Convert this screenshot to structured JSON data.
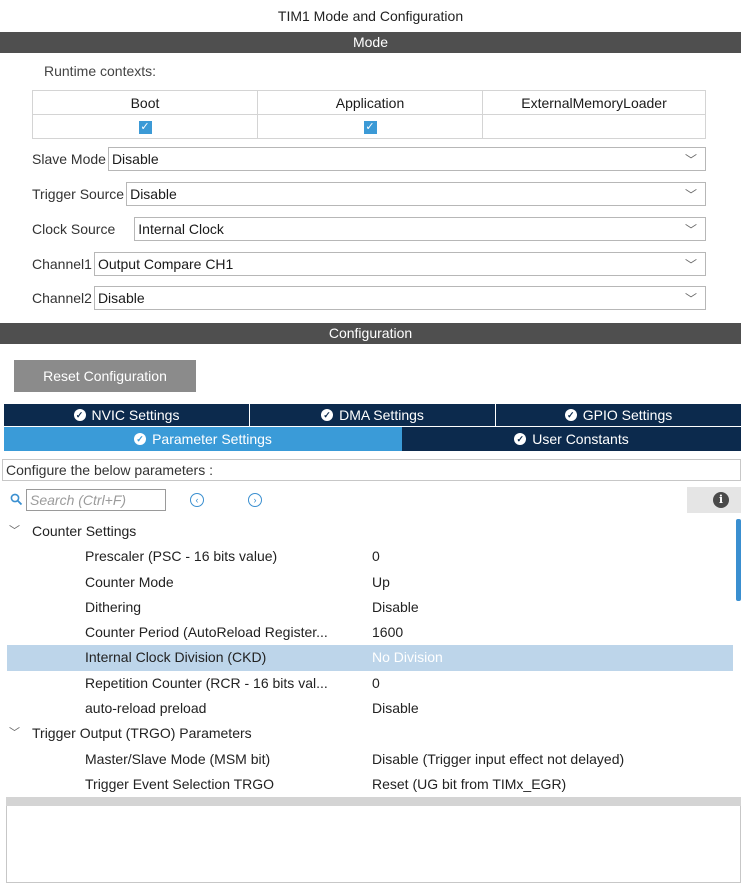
{
  "window": {
    "title": "TIM1 Mode and Configuration"
  },
  "mode": {
    "header": "Mode",
    "runtime_contexts_label": "Runtime contexts:",
    "contexts": [
      {
        "label": "Boot",
        "checked": true
      },
      {
        "label": "Application",
        "checked": true
      },
      {
        "label": "ExternalMemoryLoader",
        "checked": false
      }
    ],
    "fields": [
      {
        "label": "Slave Mode",
        "value": "Disable"
      },
      {
        "label": "Trigger Source",
        "value": "Disable"
      },
      {
        "label": "Clock Source",
        "value": "Internal Clock"
      },
      {
        "label": "Channel1",
        "value": "Output Compare CH1"
      },
      {
        "label": "Channel2",
        "value": "Disable"
      }
    ]
  },
  "configuration": {
    "header": "Configuration",
    "reset_button": "Reset Configuration",
    "tabs_row1": [
      "NVIC Settings",
      "DMA Settings",
      "GPIO Settings"
    ],
    "tabs_row2": [
      "Parameter Settings",
      "User Constants"
    ],
    "active_tab": "Parameter Settings",
    "configure_text": "Configure the below parameters :",
    "search_placeholder": "Search (Ctrl+F)",
    "groups": [
      {
        "name": "Counter Settings",
        "params": [
          {
            "name": "Prescaler (PSC - 16 bits value)",
            "value": "0"
          },
          {
            "name": "Counter Mode",
            "value": "Up"
          },
          {
            "name": "Dithering",
            "value": "Disable"
          },
          {
            "name": "Counter Period (AutoReload Register...",
            "value": "1600"
          },
          {
            "name": "Internal Clock Division (CKD)",
            "value": "No Division",
            "selected": true
          },
          {
            "name": "Repetition Counter (RCR - 16 bits val...",
            "value": "0"
          },
          {
            "name": "auto-reload preload",
            "value": "Disable"
          }
        ]
      },
      {
        "name": "Trigger Output (TRGO) Parameters",
        "params": [
          {
            "name": "Master/Slave Mode (MSM bit)",
            "value": "Disable (Trigger input effect not delayed)"
          },
          {
            "name": "Trigger Event Selection TRGO",
            "value": "Reset (UG bit from TIMx_EGR)"
          }
        ]
      }
    ]
  },
  "colors": {
    "header_bar": "#4f4f4f",
    "tab_dark": "#0c2a4d",
    "tab_active": "#3a9bd8",
    "selection": "#bdd5ea",
    "checkbox": "#3c9ad6"
  },
  "icons": {
    "search": "search-icon",
    "prev": "arrow-left-circle-icon",
    "next": "arrow-right-circle-icon",
    "info": "info-icon",
    "check": "check-circle-icon",
    "expand": "chevron-down-icon"
  }
}
